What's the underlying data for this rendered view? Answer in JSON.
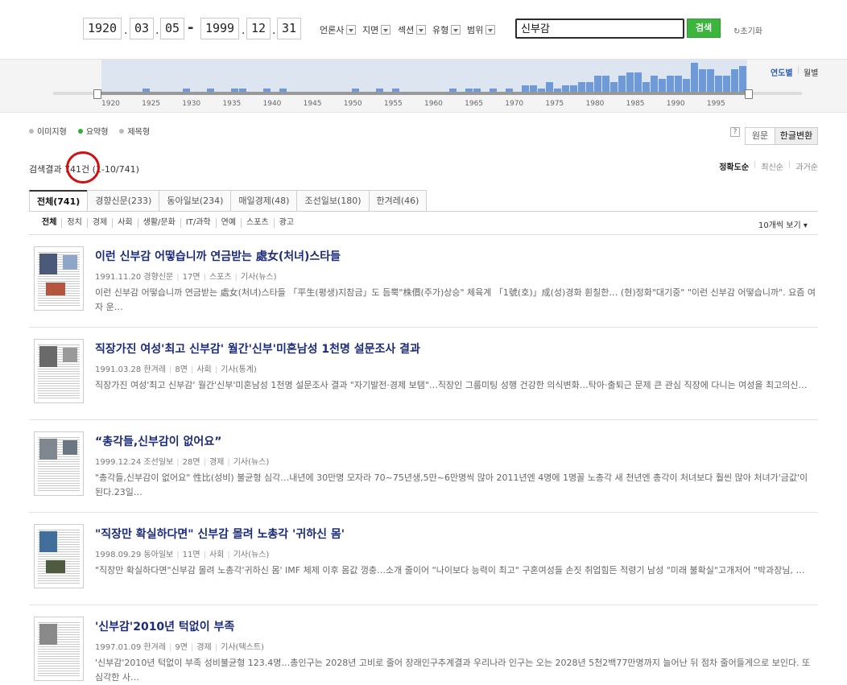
{
  "dates": {
    "from": {
      "year": "1920",
      "month": "03",
      "day": "05"
    },
    "to": {
      "year": "1999",
      "month": "12",
      "day": "31"
    },
    "dash": "-",
    "dot": "."
  },
  "filters": [
    {
      "label": "언론사"
    },
    {
      "label": "지면"
    },
    {
      "label": "섹션"
    },
    {
      "label": "유형"
    },
    {
      "label": "범위"
    }
  ],
  "search": {
    "value": "신부감",
    "button": "검색",
    "reset": "초기화"
  },
  "histogram": {
    "view_year": "연도별",
    "view_month": "월별",
    "ticks": [
      "1920",
      "1925",
      "1930",
      "1935",
      "1940",
      "1945",
      "1950",
      "1955",
      "1960",
      "1965",
      "1970",
      "1975",
      "1980",
      "1985",
      "1990",
      "1995"
    ],
    "counts": [
      0,
      0,
      0,
      0,
      0,
      1,
      0,
      0,
      0,
      0,
      1,
      0,
      0,
      1,
      0,
      0,
      1,
      1,
      0,
      0,
      1,
      0,
      1,
      0,
      0,
      0,
      0,
      0,
      0,
      0,
      0,
      1,
      0,
      0,
      1,
      0,
      1,
      0,
      0,
      0,
      0,
      0,
      0,
      1,
      0,
      1,
      1,
      0,
      1,
      0,
      1,
      0,
      2,
      2,
      1,
      3,
      1,
      2,
      2,
      3,
      3,
      5,
      5,
      3,
      5,
      6,
      6,
      3,
      5,
      4,
      5,
      5,
      4,
      9,
      7,
      7,
      5,
      5,
      7,
      8
    ]
  },
  "view_types": [
    {
      "label": "이미지형",
      "selected": false
    },
    {
      "label": "요약형",
      "selected": true
    },
    {
      "label": "제목형",
      "selected": false
    }
  ],
  "help": "?",
  "script_toggle": {
    "original": "원문",
    "hangul": "한글변환"
  },
  "result_count": {
    "prefix": "검색결과",
    "count": "741건",
    "range": "(1-10/741)"
  },
  "sort": [
    "정확도순",
    "최신순",
    "과거순"
  ],
  "tabs": [
    {
      "label": "전체(741)",
      "active": true
    },
    {
      "label": "경향신문(233)",
      "active": false
    },
    {
      "label": "동아일보(234)",
      "active": false
    },
    {
      "label": "매일경제(48)",
      "active": false
    },
    {
      "label": "조선일보(180)",
      "active": false
    },
    {
      "label": "한겨레(46)",
      "active": false
    }
  ],
  "subcategories": [
    "전체",
    "정치",
    "경제",
    "사회",
    "생활/문화",
    "IT/과학",
    "연예",
    "스포츠",
    "광고"
  ],
  "per_page": "10개씩 보기 ▾",
  "results": [
    {
      "title": "이런 신부감 어떻습니까 연금받는 處女(처녀)스타들",
      "meta": [
        "1991.11.20 경향신문",
        "17면",
        "스포츠",
        "기사(뉴스)"
      ],
      "snippet": "이런 신부감 어떻습니까 연금받는 處女(처녀)스타들 「平生(평생)지참금」도 듬뿍\"株價(주가)상승\" 체육계 「1號(호)」成(성)경화 휜칠한… (현)정화\"대기중\" \"이런 신부감 어떻습니까\". 요즘 여자 운…"
    },
    {
      "title": "직장가진 여성'최고 신부감' 월간'신부'미혼남성 1천명 설문조사 결과",
      "meta": [
        "1991.03.28 한겨레",
        "8면",
        "사회",
        "기사(통계)"
      ],
      "snippet": "직장가진 여성'최고 신부감' 월간'신부'미혼남성 1천명 설문조사 결과 \"자기발전·경제 보탬\"…직장인 그룹미팅 성행 건강한 의식변화…탁아·출퇴근 문제 큰 관심 직장에 다니는 여성을 최고의신…"
    },
    {
      "title": "“총각들,신부감이 없어요”",
      "meta": [
        "1999.12.24 조선일보",
        "28면",
        "경제",
        "기사(뉴스)"
      ],
      "snippet": "\"총각들,신부감이 없어요\" 性比(성비) 불균형 심각…내년에 30만명 모자라 70~75년생,5만~6만명씩 많아 2011년엔 4명에 1명꼴 노총각 새 천년엔 총각이 처녀보다 훨씬 많아 처녀가'금값'이 된다.23일…"
    },
    {
      "title": "\"직장만 확실하다면\" 신부감 몰려 노총각 '귀하신 몸'",
      "meta": [
        "1998.09.29 동아일보",
        "11면",
        "사회",
        "기사(뉴스)"
      ],
      "snippet": "\"직장만 확실하다면\"신부감 몰려 노총각'귀하신 몸' IMF 체제 이후 몸값 껑충…소개 줄이어 \"나이보다 능력이 최고\" 구혼여성들 손짓 취업힘든 적령기 남성 \"미래 불확실\"고개저어 \"박과장님, …"
    },
    {
      "title": "'신부감'2010년 턱없이 부족",
      "meta": [
        "1997.01.09 한겨레",
        "9면",
        "경제",
        "기사(텍스트)"
      ],
      "snippet": "'신부감'2010년 턱없이 부족 성비불균형 123.4명…총인구는 2028년 고비로 줄어 장래인구추계결과 우리나라 인구는 오는 2028년 5천2백77만명까지 늘어난 뒤 점차 줄어들게으로 보인다. 또 심각한 사…"
    }
  ]
}
